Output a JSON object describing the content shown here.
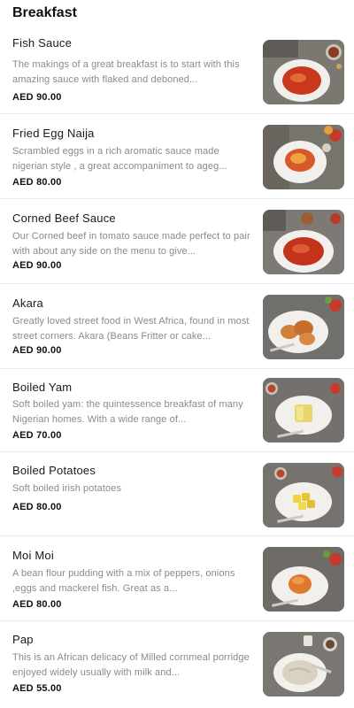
{
  "section": {
    "title": "Breakfast"
  },
  "items": [
    {
      "name": "Fish Sauce",
      "description": "The makings of a great breakfast is to start with this amazing sauce with flaked and deboned...",
      "price": "AED 90.00",
      "image": "fish-sauce-dish-image"
    },
    {
      "name": "Fried Egg Naija",
      "description": "Scrambled eggs in a rich aromatic sauce made nigerian style , a great accompaniment to ageg...",
      "price": "AED 80.00",
      "image": "fried-egg-dish-image"
    },
    {
      "name": "Corned Beef Sauce",
      "description": "Our Corned beef in tomato sauce made perfect to pair with about any side on the menu to give...",
      "price": "AED 90.00",
      "image": "corned-beef-dish-image"
    },
    {
      "name": "Akara",
      "description": "Greatly loved street food in West Africa, found in most street corners. Akara (Beans Fritter or cake...",
      "price": "AED 90.00",
      "image": "akara-dish-image"
    },
    {
      "name": "Boiled Yam",
      "description": "Soft boiled yam: the quintessence breakfast of many Nigerian homes. With a wide range of...",
      "price": "AED 70.00",
      "image": "boiled-yam-dish-image"
    },
    {
      "name": "Boiled Potatoes",
      "description": "Soft boiled irish potatoes",
      "price": "AED 80.00",
      "image": "boiled-potatoes-dish-image"
    },
    {
      "name": "Moi Moi",
      "description": "A bean flour pudding with a mix of peppers, onions ,eggs and mackerel fish. Great as a...",
      "price": "AED 80.00",
      "image": "moi-moi-dish-image"
    },
    {
      "name": "Pap",
      "description": "This is an African delicacy of Milled cornmeal porridge enjoyed widely usually with milk and...",
      "price": "AED 55.00",
      "image": "pap-dish-image"
    }
  ]
}
